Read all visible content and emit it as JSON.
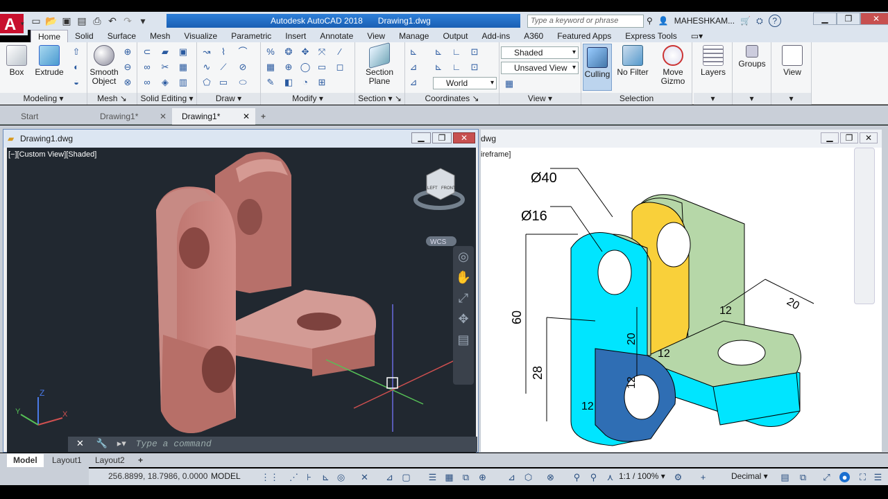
{
  "app": {
    "title": "Autodesk AutoCAD 2018",
    "file": "Drawing1.dwg"
  },
  "search": {
    "placeholder": "Type a keyword or phrase"
  },
  "user": {
    "name": "MAHESHKAM..."
  },
  "tabs": [
    "Home",
    "Solid",
    "Surface",
    "Mesh",
    "Visualize",
    "Parametric",
    "Insert",
    "Annotate",
    "View",
    "Manage",
    "Output",
    "Add-ins",
    "A360",
    "Featured Apps",
    "Express Tools"
  ],
  "ribbon": {
    "modeling": {
      "label": "Modeling",
      "box": "Box",
      "extrude": "Extrude"
    },
    "mesh": {
      "label": "Mesh",
      "smooth": "Smooth",
      "object": "Object"
    },
    "solid_editing": {
      "label": "Solid Editing"
    },
    "draw": {
      "label": "Draw"
    },
    "modify": {
      "label": "Modify"
    },
    "section": {
      "label": "Section",
      "btn1": "Section",
      "btn2": "Plane"
    },
    "coordinates": {
      "label": "Coordinates",
      "world": "World"
    },
    "view": {
      "label": "View",
      "visual_style": "Shaded",
      "saved_view": "Unsaved View"
    },
    "selection": {
      "label": "Selection",
      "culling": "Culling",
      "nofilter": "No Filter",
      "move": "Move",
      "gizmo": "Gizmo"
    },
    "layers": {
      "label": "Layers"
    },
    "groups": {
      "label": "Groups"
    },
    "view2": {
      "label": "View"
    }
  },
  "doc_tabs": [
    "Start",
    "Drawing1*",
    "Drawing1*"
  ],
  "left_window": {
    "title": "Drawing1.dwg",
    "view_label": "[−][Custom View][Shaded]",
    "wcs": "WCS",
    "cube_face": "LEFT",
    "cube_face2": "FRONT"
  },
  "right_window": {
    "title_frag": "dwg",
    "view_frag": "ireframe]"
  },
  "dims": {
    "d40": "Ø40",
    "d16": "Ø16",
    "d60": "60",
    "d28": "28",
    "d20a": "20",
    "d12a": "12",
    "d12b": "12",
    "d12c": "12",
    "d12d": "12",
    "d20b": "20"
  },
  "command": {
    "placeholder": "Type a command"
  },
  "layout_tabs": [
    "Model",
    "Layout1",
    "Layout2"
  ],
  "status": {
    "coords": "256.8899, 18.7986, 0.0000",
    "space": "MODEL",
    "scale": "1:1 / 100%",
    "units": "Decimal"
  },
  "colors": {
    "accent": "#2d7fd6",
    "shaded_part": "#c98079",
    "cyan": "#00e5ff",
    "green": "#b6d7a8",
    "yellow": "#f9d03a",
    "blue": "#2f6eb4"
  }
}
